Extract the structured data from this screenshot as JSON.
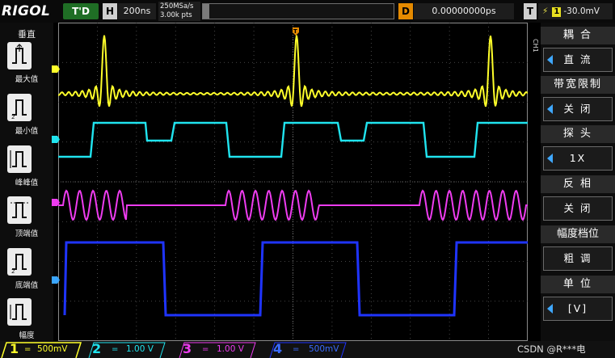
{
  "header": {
    "brand": "RIGOL",
    "run_mode": "T'D",
    "horizontal_badge": "H",
    "timebase": "200ns",
    "sample_rate": "250MSa/s",
    "memory_depth": "3.00k pts",
    "delay_badge": "D",
    "delay": "0.00000000ps",
    "trigger_badge": "T",
    "trigger_edge_icon": "rising-edge-icon",
    "trigger_source": "1",
    "trigger_level": "-30.0mV"
  },
  "left_menu": {
    "title": "垂直",
    "items": [
      {
        "label": "最大值",
        "icon": "measure-max-icon"
      },
      {
        "label": "最小值",
        "icon": "measure-min-icon"
      },
      {
        "label": "峰峰值",
        "icon": "measure-vpp-icon"
      },
      {
        "label": "顶端值",
        "icon": "measure-top-icon"
      },
      {
        "label": "底端值",
        "icon": "measure-base-icon"
      },
      {
        "label": "幅度",
        "icon": "measure-amplitude-icon"
      }
    ]
  },
  "right_menu": {
    "channel_tag": "CH1",
    "items": [
      {
        "title": "耦 合",
        "value": "直 流",
        "has_arrow": true
      },
      {
        "title": "带宽限制",
        "value": "关 闭",
        "has_arrow": true
      },
      {
        "title": "探 头",
        "value": "1X",
        "has_arrow": true
      },
      {
        "title": "反 相",
        "value": "关 闭",
        "has_arrow": false
      },
      {
        "title": "幅度档位",
        "value": "粗 调",
        "has_arrow": false
      },
      {
        "title": "单 位",
        "value": "[V]",
        "has_arrow": true
      }
    ]
  },
  "channels": [
    {
      "number": "1",
      "coupling": "=",
      "scale": "500mV",
      "color": "#ffff2a"
    },
    {
      "number": "2",
      "coupling": "=",
      "scale": "1.00 V",
      "color": "#20e4ef"
    },
    {
      "number": "3",
      "coupling": "=",
      "scale": "1.00 V",
      "color": "#ee3cf0"
    },
    {
      "number": "4",
      "coupling": "=",
      "scale": "500mV",
      "color": "#1f34ff"
    }
  ],
  "watermark": "CSDN @R***电"
}
